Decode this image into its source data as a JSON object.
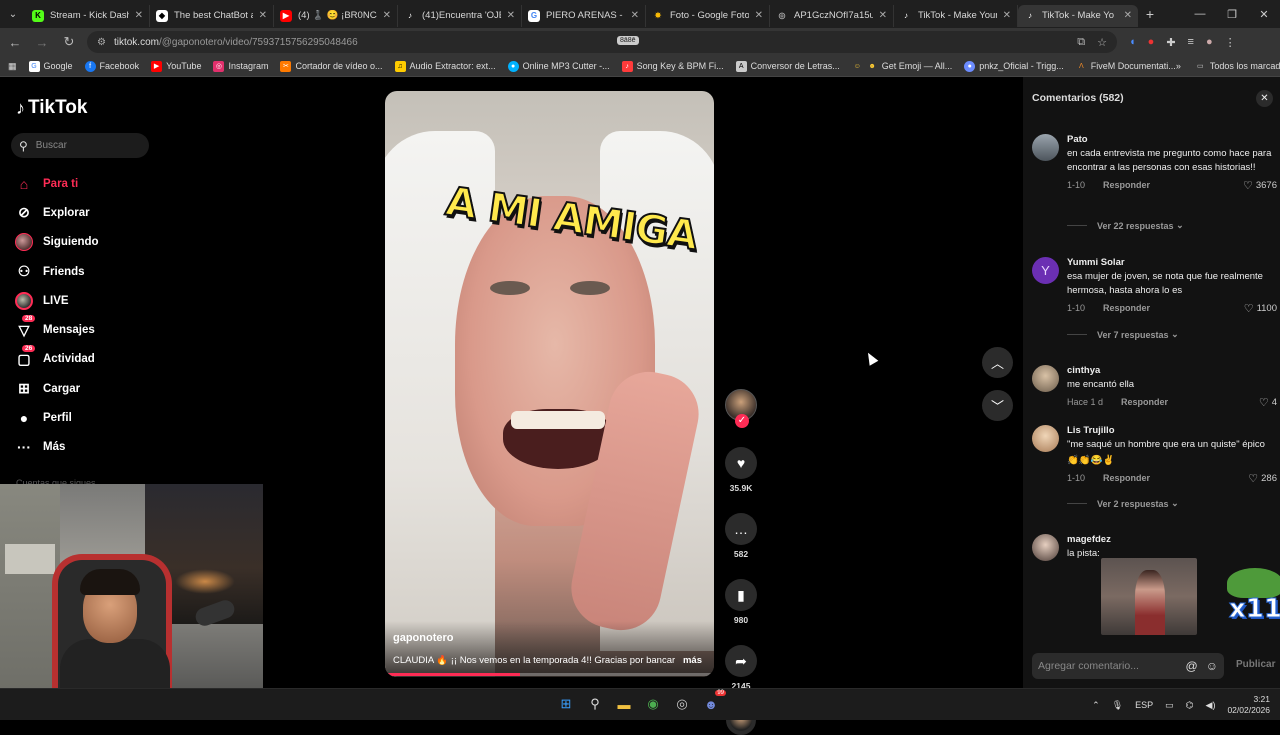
{
  "browser": {
    "tabs": [
      {
        "label": "Stream - Kick Dashbo",
        "icon": "kick-icon",
        "color": "#53fc18"
      },
      {
        "label": "The best ChatBot and",
        "icon": "chatbot-icon",
        "color": "#ffffff"
      },
      {
        "label": "(4) ♟️ 😊 ¡BR0NC4S",
        "icon": "youtube-icon",
        "color": "#ff0000"
      },
      {
        "label": "(41)Encuentra 'OJERA",
        "icon": "tiktok-icon",
        "color": "#ffffff"
      },
      {
        "label": "PIERO ARENAS - Bus",
        "icon": "google-icon",
        "color": "#ffffff"
      },
      {
        "label": "Foto - Google Fotos",
        "icon": "google-photos-icon",
        "color": "#fbbc05"
      },
      {
        "label": "AP1GczNOfI7a15uW",
        "icon": "globe-icon",
        "color": "#aaaaaa"
      },
      {
        "label": "TikTok - Make Your D",
        "icon": "tiktok-icon",
        "color": "#ffffff"
      },
      {
        "label": "TikTok - Make Yo",
        "icon": "tiktok-icon",
        "color": "#ffffff",
        "active": true
      }
    ],
    "url_host": "tiktok.com",
    "url_path": "/@gaponotero/video/7593715756295048466",
    "center_badge": "8ā8ē",
    "bookmarks": [
      {
        "label": "Google",
        "icon": "google-icon",
        "color": "#4285f4"
      },
      {
        "label": "Facebook",
        "icon": "facebook-icon",
        "color": "#1877f2"
      },
      {
        "label": "YouTube",
        "icon": "youtube-icon",
        "color": "#ff0000"
      },
      {
        "label": "Instagram",
        "icon": "instagram-icon",
        "color": "#e1306c"
      },
      {
        "label": "Cortador de vídeo o...",
        "icon": "scissors-icon",
        "color": "#ff7a00"
      },
      {
        "label": "Audio Extractor: ext...",
        "icon": "audio-icon",
        "color": "#ffcc00"
      },
      {
        "label": "Online MP3 Cutter -...",
        "icon": "mp3-icon",
        "color": "#00b2ff"
      },
      {
        "label": "Song Key & BPM Fi...",
        "icon": "music-icon",
        "color": "#ff3b3b"
      },
      {
        "label": "Conversor de Letras...",
        "icon": "letters-icon",
        "color": "#cccccc"
      },
      {
        "label": "Get Emoji — All...",
        "icon": "emoji-icon",
        "color": "#ffcc33"
      },
      {
        "label": "pnkz_Oficial - Trigg...",
        "icon": "trigger-icon",
        "color": "#6c8cff"
      },
      {
        "label": "FiveM Documentati...",
        "icon": "fivem-icon",
        "color": "#f28c28"
      }
    ],
    "all_bookmarks": "Todos los marcadores"
  },
  "tiktok": {
    "logo": "TikTok",
    "search_placeholder": "Buscar",
    "menu": [
      {
        "label": "Para ti",
        "icon": "home-icon",
        "active": true
      },
      {
        "label": "Explorar",
        "icon": "compass-icon"
      },
      {
        "label": "Siguiendo",
        "icon": "following-avatar-icon"
      },
      {
        "label": "Friends",
        "icon": "friends-icon"
      },
      {
        "label": "LIVE",
        "icon": "live-avatar-icon"
      },
      {
        "label": "Mensajes",
        "icon": "messages-icon",
        "badge": "28"
      },
      {
        "label": "Actividad",
        "icon": "activity-icon",
        "badge": "26"
      },
      {
        "label": "Cargar",
        "icon": "upload-icon"
      },
      {
        "label": "Perfil",
        "icon": "profile-icon"
      },
      {
        "label": "Más",
        "icon": "more-icon"
      }
    ],
    "following_accounts_heading": "Cuentas que sigues",
    "video": {
      "sticker_text": "A MI AMIGA",
      "username": "gaponotero",
      "description": "CLAUDIA 🔥 ¡¡ Nos vemos en la temporada 4!! Gracias por bancar",
      "more": "más",
      "progress_percent": 41
    },
    "actions": {
      "likes": "35.9K",
      "comments": "582",
      "saves": "980",
      "shares": "2145"
    }
  },
  "comments_panel": {
    "title": "Comentarios",
    "count": "(582)",
    "comments": [
      {
        "name": "Pato",
        "text": "en cada entrevista me pregunto como hace para encontrar a las personas con esas historias!!",
        "date": "1-10",
        "reply": "Responder",
        "likes": "3676",
        "more": "Ver 22 respuestas"
      },
      {
        "name": "Yummi Solar",
        "avatar_letter": "Y",
        "text": "esa mujer de joven, se nota que fue realmente hermosa, hasta ahora lo es",
        "date": "1-10",
        "reply": "Responder",
        "likes": "1100",
        "more": "Ver 7 respuestas"
      },
      {
        "name": "cinthya",
        "text": "me encantó ella",
        "date": "Hace 1 d",
        "reply": "Responder",
        "likes": "4"
      },
      {
        "name": "Lis Trujillo",
        "text": "\"me saqué un hombre que era un quiste\" épico",
        "emojis": "👏👏😂✌",
        "date": "1-10",
        "reply": "Responder",
        "likes": "286",
        "more": "Ver 2 respuestas"
      },
      {
        "name": "magefdez",
        "text": "la pista:",
        "sticker": "x11"
      }
    ],
    "input_placeholder": "Agregar comentario...",
    "post": "Publicar"
  },
  "taskbar": {
    "language": "ESP",
    "time": "3:21",
    "date": "02/02/2026",
    "discord_badge": "99"
  }
}
